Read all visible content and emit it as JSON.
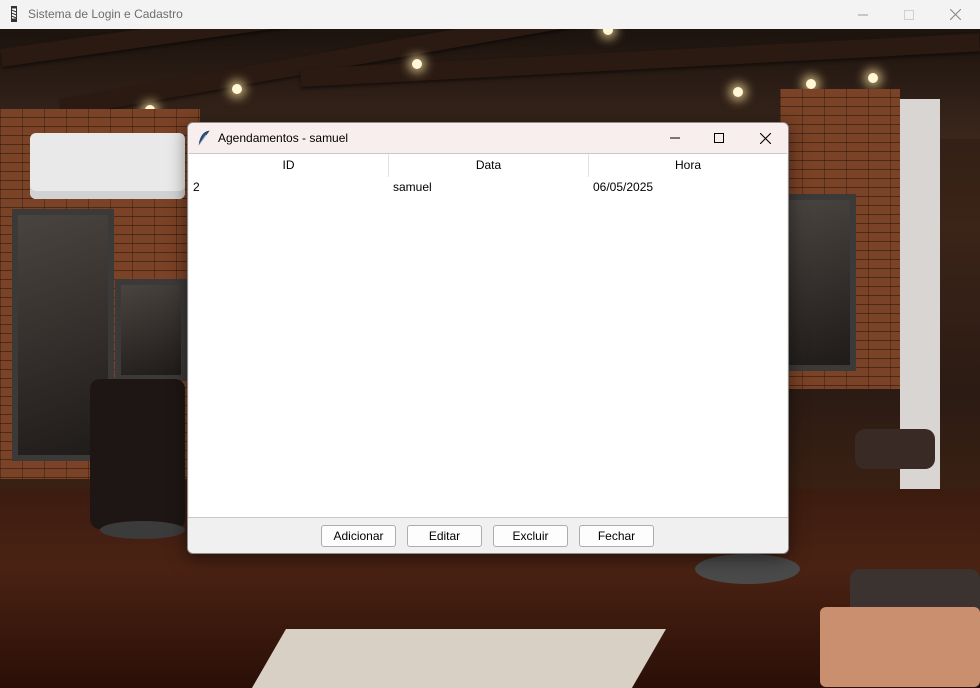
{
  "main_window": {
    "title": "Sistema de Login e Cadastro",
    "icon": "barber-pole-icon",
    "controls": [
      "minimize-icon",
      "maximize-icon",
      "close-icon"
    ]
  },
  "dialog": {
    "title": "Agendamentos - samuel",
    "icon": "feather-icon",
    "controls": [
      "minimize-icon",
      "maximize-icon",
      "close-icon"
    ],
    "table": {
      "columns": [
        "ID",
        "Data",
        "Hora"
      ],
      "rows": [
        [
          "2",
          "samuel",
          "06/05/2025"
        ]
      ]
    },
    "buttons": {
      "add": "Adicionar",
      "edit": "Editar",
      "delete": "Excluir",
      "close": "Fechar"
    }
  },
  "colors": {
    "dialog_titlebar": "#f9eeee",
    "main_titlebar": "#f3f3f3",
    "button_bar": "#f0f0f0"
  }
}
